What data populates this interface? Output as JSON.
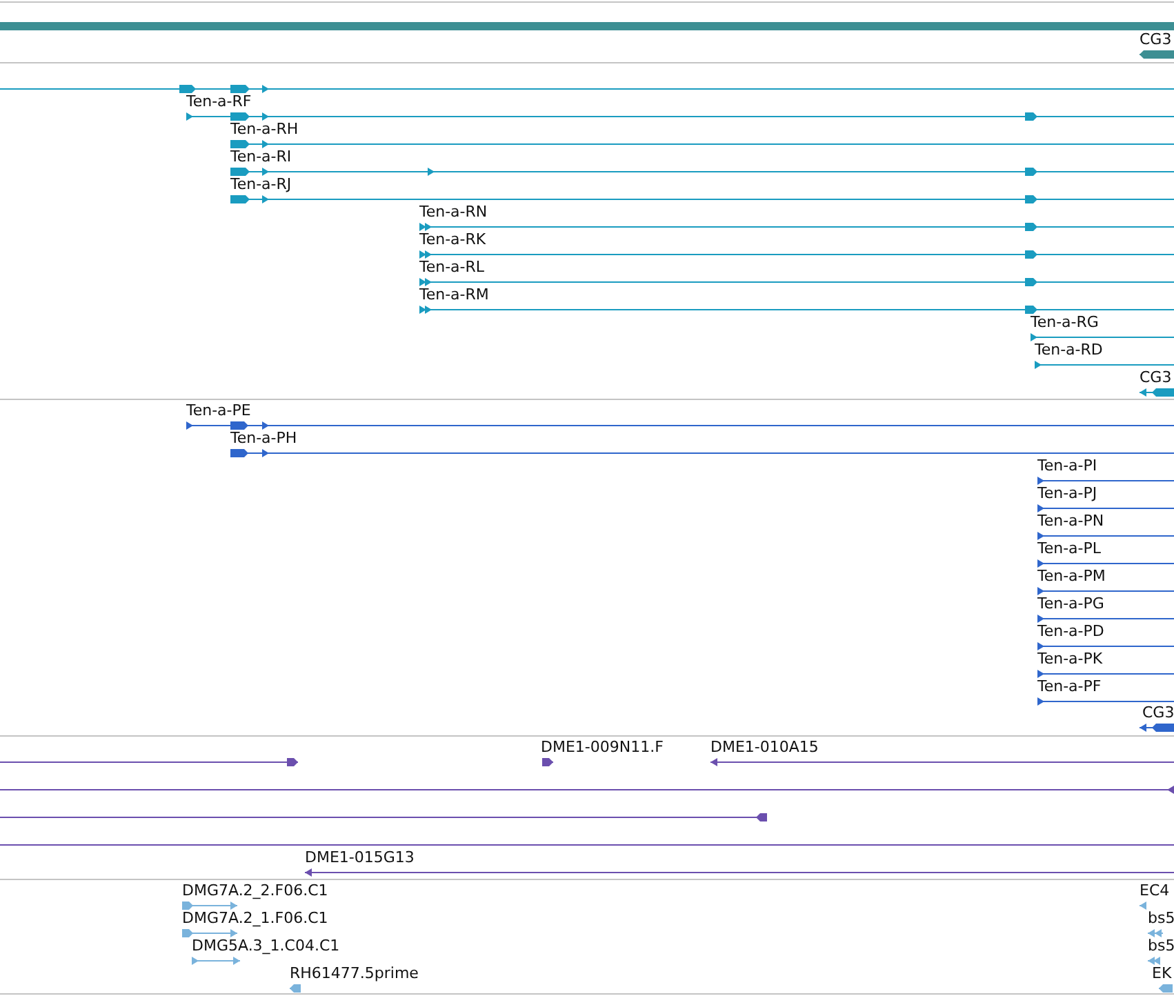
{
  "tracks": [
    {
      "color": "#3d8f93",
      "features": [
        {
          "kind": "thick"
        },
        {
          "label": "CG3",
          "kind": "reverse"
        }
      ]
    },
    {
      "color": "#1a9cc0",
      "features": [
        {
          "kind": "forward"
        },
        {
          "label": "Ten-a-RF",
          "kind": "forward"
        },
        {
          "label": "Ten-a-RH",
          "kind": "forward"
        },
        {
          "label": "Ten-a-RI",
          "kind": "forward"
        },
        {
          "label": "Ten-a-RJ",
          "kind": "forward"
        },
        {
          "label": "Ten-a-RN",
          "kind": "forward"
        },
        {
          "label": "Ten-a-RK",
          "kind": "forward"
        },
        {
          "label": "Ten-a-RL",
          "kind": "forward"
        },
        {
          "label": "Ten-a-RM",
          "kind": "forward"
        },
        {
          "label": "Ten-a-RG",
          "kind": "forward"
        },
        {
          "label": "Ten-a-RD",
          "kind": "forward"
        },
        {
          "label": "CG3",
          "kind": "reverse"
        }
      ]
    },
    {
      "color": "#2f66cc",
      "features": [
        {
          "label": "Ten-a-PE",
          "kind": "forward"
        },
        {
          "label": "Ten-a-PH",
          "kind": "forward"
        },
        {
          "label": "Ten-a-PI",
          "kind": "forward"
        },
        {
          "label": "Ten-a-PJ",
          "kind": "forward"
        },
        {
          "label": "Ten-a-PN",
          "kind": "forward"
        },
        {
          "label": "Ten-a-PL",
          "kind": "forward"
        },
        {
          "label": "Ten-a-PM",
          "kind": "forward"
        },
        {
          "label": "Ten-a-PG",
          "kind": "forward"
        },
        {
          "label": "Ten-a-PD",
          "kind": "forward"
        },
        {
          "label": "Ten-a-PK",
          "kind": "forward"
        },
        {
          "label": "Ten-a-PF",
          "kind": "forward"
        },
        {
          "label": "CG3",
          "kind": "reverse"
        }
      ]
    },
    {
      "color": "#6b4fae",
      "features": [
        {
          "kind": "forward"
        },
        {
          "label": "DME1-009N11.F",
          "kind": "forward"
        },
        {
          "label": "DME1-010A15",
          "kind": "reverse"
        },
        {
          "kind": "reverse"
        },
        {
          "kind": "reverse"
        },
        {
          "kind": "plain"
        },
        {
          "label": "DME1-015G13",
          "kind": "reverse"
        }
      ]
    },
    {
      "color": "#7ab3dc",
      "features": [
        {
          "label": "DMG7A.2_2.F06.C1",
          "kind": "forward"
        },
        {
          "label": "DMG7A.2_1.F06.C1",
          "kind": "forward"
        },
        {
          "label": "DMG5A.3_1.C04.C1",
          "kind": "forward"
        },
        {
          "label": "RH61477.5prime",
          "kind": "reverse"
        },
        {
          "label": "EC4",
          "kind": "reverse"
        },
        {
          "label": "bs5",
          "kind": "reverse"
        },
        {
          "label": "bs5",
          "kind": "reverse"
        },
        {
          "label": "EK",
          "kind": "reverse"
        }
      ]
    }
  ]
}
